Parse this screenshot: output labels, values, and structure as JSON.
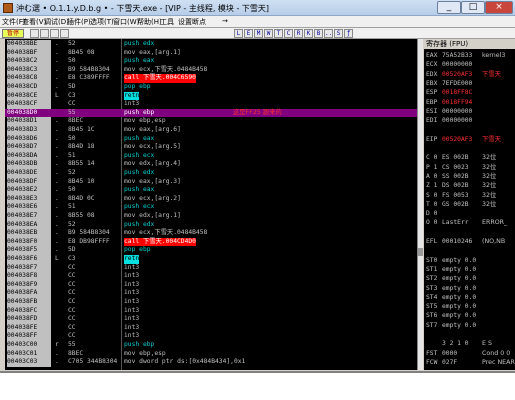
{
  "window": {
    "title": "沖む選 • O.1.1.y.D.b.g • - 下雪天.exe - [VIP - 主线程, 模块 - 下雪天]",
    "controls": [
      "_",
      "□",
      "×"
    ]
  },
  "menu": [
    "文件(F)",
    "查看(V)",
    "调试(D)",
    "插件(P)",
    "选项(T)",
    "窗口(W)",
    "帮助(H)",
    "工具",
    "设置断点",
    "→"
  ],
  "toolbar": {
    "pause_label": "暂停",
    "buttons": [
      "L",
      "E",
      "M",
      "W",
      "T",
      "C",
      "R",
      "K",
      "B",
      "...",
      "S",
      "ƒ"
    ]
  },
  "cpu": {
    "rows": [
      {
        "addr": "004038BE",
        "mk": ".",
        "hex": "52",
        "asm": "push edx",
        "style": "stk",
        "comment": ""
      },
      {
        "addr": "004038BF",
        "mk": ".",
        "hex": "8B45 08",
        "asm": "mov eax,[arg.1]",
        "style": "",
        "comment": ""
      },
      {
        "addr": "004038C2",
        "mk": ".",
        "hex": "50",
        "asm": "push eax",
        "style": "stk",
        "comment": ""
      },
      {
        "addr": "004038C3",
        "mk": ".",
        "hex": "B9 584B8304",
        "asm": "mov ecx,下雪天.0484B458",
        "style": "",
        "comment": ""
      },
      {
        "addr": "004038C8",
        "mk": ".",
        "hex": "E8 C389FFFF",
        "asm": "call 下雪天.004C6590",
        "style": "call",
        "comment": ""
      },
      {
        "addr": "004038CD",
        "mk": ".",
        "hex": "5D",
        "asm": "pop ebp",
        "style": "stk",
        "comment": ""
      },
      {
        "addr": "004038CE",
        "mk": "L",
        "hex": "C3",
        "asm": "retn",
        "style": "jmp",
        "comment": ""
      },
      {
        "addr": "004038CF",
        "mk": "",
        "hex": "CC",
        "asm": "int3",
        "style": "",
        "comment": ""
      },
      {
        "addr": "004038D0",
        "mk": "",
        "hex": "55",
        "asm": "push ebp",
        "style": "sel",
        "comment": "这是FF25 跟来的"
      },
      {
        "addr": "004038D1",
        "mk": ".",
        "hex": "8BEC",
        "asm": "mov ebp,esp",
        "style": "",
        "comment": ""
      },
      {
        "addr": "004038D3",
        "mk": ".",
        "hex": "8B45 1C",
        "asm": "mov eax,[arg.6]",
        "style": "",
        "comment": ""
      },
      {
        "addr": "004038D6",
        "mk": ".",
        "hex": "50",
        "asm": "push eax",
        "style": "stk",
        "comment": ""
      },
      {
        "addr": "004038D7",
        "mk": ".",
        "hex": "8B4D 18",
        "asm": "mov ecx,[arg.5]",
        "style": "",
        "comment": ""
      },
      {
        "addr": "004038DA",
        "mk": ".",
        "hex": "51",
        "asm": "push ecx",
        "style": "stk",
        "comment": ""
      },
      {
        "addr": "004038DB",
        "mk": ".",
        "hex": "8B55 14",
        "asm": "mov edx,[arg.4]",
        "style": "",
        "comment": ""
      },
      {
        "addr": "004038DE",
        "mk": ".",
        "hex": "52",
        "asm": "push edx",
        "style": "stk",
        "comment": ""
      },
      {
        "addr": "004038DF",
        "mk": ".",
        "hex": "8B45 10",
        "asm": "mov eax,[arg.3]",
        "style": "",
        "comment": ""
      },
      {
        "addr": "004038E2",
        "mk": ".",
        "hex": "50",
        "asm": "push eax",
        "style": "stk",
        "comment": ""
      },
      {
        "addr": "004038E3",
        "mk": ".",
        "hex": "8B4D 0C",
        "asm": "mov ecx,[arg.2]",
        "style": "",
        "comment": ""
      },
      {
        "addr": "004038E6",
        "mk": ".",
        "hex": "51",
        "asm": "push ecx",
        "style": "stk",
        "comment": ""
      },
      {
        "addr": "004038E7",
        "mk": ".",
        "hex": "8B55 08",
        "asm": "mov edx,[arg.1]",
        "style": "",
        "comment": ""
      },
      {
        "addr": "004038EA",
        "mk": ".",
        "hex": "52",
        "asm": "push edx",
        "style": "stk",
        "comment": ""
      },
      {
        "addr": "004038EB",
        "mk": ".",
        "hex": "B9 584B8304",
        "asm": "mov ecx,下雪天.0484B458",
        "style": "",
        "comment": ""
      },
      {
        "addr": "004038F0",
        "mk": ".",
        "hex": "E8 DB98FFFF",
        "asm": "call 下雪天.004CD4D0",
        "style": "call",
        "comment": ""
      },
      {
        "addr": "004038F5",
        "mk": ".",
        "hex": "5D",
        "asm": "pop ebp",
        "style": "stk",
        "comment": ""
      },
      {
        "addr": "004038F6",
        "mk": "L",
        "hex": "C3",
        "asm": "retn",
        "style": "jmp",
        "comment": ""
      },
      {
        "addr": "004038F7",
        "mk": "",
        "hex": "CC",
        "asm": "int3",
        "style": "",
        "comment": ""
      },
      {
        "addr": "004038F8",
        "mk": "",
        "hex": "CC",
        "asm": "int3",
        "style": "",
        "comment": ""
      },
      {
        "addr": "004038F9",
        "mk": "",
        "hex": "CC",
        "asm": "int3",
        "style": "",
        "comment": ""
      },
      {
        "addr": "004038FA",
        "mk": "",
        "hex": "CC",
        "asm": "int3",
        "style": "",
        "comment": ""
      },
      {
        "addr": "004038FB",
        "mk": "",
        "hex": "CC",
        "asm": "int3",
        "style": "",
        "comment": ""
      },
      {
        "addr": "004038FC",
        "mk": "",
        "hex": "CC",
        "asm": "int3",
        "style": "",
        "comment": ""
      },
      {
        "addr": "004038FD",
        "mk": "",
        "hex": "CC",
        "asm": "int3",
        "style": "",
        "comment": ""
      },
      {
        "addr": "004038FE",
        "mk": "",
        "hex": "CC",
        "asm": "int3",
        "style": "",
        "comment": ""
      },
      {
        "addr": "004038FF",
        "mk": "",
        "hex": "CC",
        "asm": "int3",
        "style": "",
        "comment": ""
      },
      {
        "addr": "00403C00",
        "mk": "r",
        "hex": "55",
        "asm": "push ebp",
        "style": "stk",
        "comment": ""
      },
      {
        "addr": "00403C01",
        "mk": ".",
        "hex": "8BEC",
        "asm": "mov ebp,esp",
        "style": "",
        "comment": ""
      },
      {
        "addr": "00403C03",
        "mk": ".",
        "hex": "C705 344B8304",
        "asm": "mov dword ptr ds:[0x484B434],0x1",
        "style": "",
        "comment": ""
      }
    ]
  },
  "registers": {
    "header": "寄存器 (FPU)",
    "items": [
      {
        "n": "EAX",
        "v": "75A52B33",
        "c": "kernel3",
        "red": false
      },
      {
        "n": "ECX",
        "v": "00000000",
        "c": "",
        "red": false
      },
      {
        "n": "EDX",
        "v": "00520AF3",
        "c": "下雪天",
        "red": true
      },
      {
        "n": "EBX",
        "v": "7EFDE000",
        "c": "",
        "red": false
      },
      {
        "n": "ESP",
        "v": "0018FF8C",
        "c": "",
        "red": true
      },
      {
        "n": "EBP",
        "v": "0018FF94",
        "c": "",
        "red": true
      },
      {
        "n": "ESI",
        "v": "00000000",
        "c": "",
        "red": false
      },
      {
        "n": "EDI",
        "v": "00000000",
        "c": "",
        "red": false
      },
      {
        "n": "",
        "v": "",
        "c": "",
        "red": false
      },
      {
        "n": "EIP",
        "v": "00520AF3",
        "c": "下雪天",
        "red": true
      },
      {
        "n": "",
        "v": "",
        "c": "",
        "red": false
      },
      {
        "n": "C 0",
        "v": "ES 002B",
        "c": "32位",
        "red": false
      },
      {
        "n": "P 1",
        "v": "CS 0023",
        "c": "32位",
        "red": false
      },
      {
        "n": "A 0",
        "v": "SS 002B",
        "c": "32位",
        "red": false
      },
      {
        "n": "Z 1",
        "v": "DS 002B",
        "c": "32位",
        "red": false
      },
      {
        "n": "S 0",
        "v": "FS 0053",
        "c": "32位",
        "red": false
      },
      {
        "n": "T 0",
        "v": "GS 002B",
        "c": "32位",
        "red": false
      },
      {
        "n": "D 0",
        "v": "",
        "c": "",
        "red": false
      },
      {
        "n": "O 0",
        "v": "LastErr",
        "c": "ERROR_",
        "red": false
      },
      {
        "n": "",
        "v": "",
        "c": "",
        "red": false
      },
      {
        "n": "EFL",
        "v": "00010246",
        "c": "(NO,NB",
        "red": false
      },
      {
        "n": "",
        "v": "",
        "c": "",
        "red": false
      },
      {
        "n": "ST0",
        "v": "empty 0.0",
        "c": "",
        "red": false
      },
      {
        "n": "ST1",
        "v": "empty 0.0",
        "c": "",
        "red": false
      },
      {
        "n": "ST2",
        "v": "empty 0.0",
        "c": "",
        "red": false
      },
      {
        "n": "ST3",
        "v": "empty 0.0",
        "c": "",
        "red": false
      },
      {
        "n": "ST4",
        "v": "empty 0.0",
        "c": "",
        "red": false
      },
      {
        "n": "ST5",
        "v": "empty 0.0",
        "c": "",
        "red": false
      },
      {
        "n": "ST6",
        "v": "empty 0.0",
        "c": "",
        "red": false
      },
      {
        "n": "ST7",
        "v": "empty 0.0",
        "c": "",
        "red": false
      },
      {
        "n": "",
        "v": "",
        "c": "",
        "red": false
      },
      {
        "n": "",
        "v": "3 2 1 0",
        "c": "E S",
        "red": false
      },
      {
        "n": "FST",
        "v": "0000",
        "c": "Cond 0 0",
        "red": false
      },
      {
        "n": "FCW",
        "v": "027F",
        "c": "Prec NEAR",
        "red": false
      }
    ]
  },
  "colors": {
    "selected": "#800080",
    "call": "#ff0000",
    "jump": "#00e0e0",
    "comment": "#ff3030"
  }
}
